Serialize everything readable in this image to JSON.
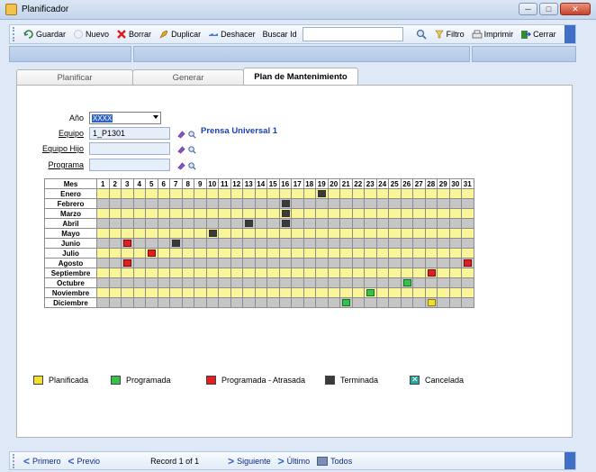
{
  "window": {
    "title": "Planificador"
  },
  "toolbar": {
    "guardar": "Guardar",
    "nuevo": "Nuevo",
    "borrar": "Borrar",
    "duplicar": "Duplicar",
    "deshacer": "Deshacer",
    "buscar_id": "Buscar Id",
    "filtro": "Filtro",
    "imprimir": "Imprimir",
    "cerrar": "Cerrar"
  },
  "tabs": [
    {
      "label": "Planificar"
    },
    {
      "label": "Generar"
    },
    {
      "label": "Plan de Mantenimiento"
    }
  ],
  "form": {
    "anio_label": "Año",
    "anio_value": "XXXX",
    "equipo_label": "Equipo",
    "equipo_value": "1_P1301",
    "equipo_desc": "Prensa Universal 1",
    "equipo_hijo_label": "Equipo Hijo",
    "equipo_hijo_value": "",
    "programa_label": "Programa",
    "programa_value": ""
  },
  "calendar": {
    "header_mes": "Mes",
    "days": [
      "1",
      "2",
      "3",
      "4",
      "5",
      "6",
      "7",
      "8",
      "9",
      "10",
      "11",
      "12",
      "13",
      "14",
      "15",
      "16",
      "17",
      "18",
      "19",
      "20",
      "21",
      "22",
      "23",
      "24",
      "25",
      "26",
      "27",
      "28",
      "29",
      "30",
      "31"
    ],
    "months": [
      "Enero",
      "Febrero",
      "Marzo",
      "Abril",
      "Mayo",
      "Junio",
      "Julio",
      "Agosto",
      "Septiembre",
      "Octubre",
      "Noviembre",
      "Diciembre"
    ],
    "marks": [
      {
        "month": "Enero",
        "day": 19,
        "status": "terminada"
      },
      {
        "month": "Febrero",
        "day": 16,
        "status": "terminada"
      },
      {
        "month": "Marzo",
        "day": 16,
        "status": "terminada"
      },
      {
        "month": "Abril",
        "day": 13,
        "status": "terminada"
      },
      {
        "month": "Abril",
        "day": 16,
        "status": "terminada"
      },
      {
        "month": "Mayo",
        "day": 10,
        "status": "terminada"
      },
      {
        "month": "Junio",
        "day": 3,
        "status": "atrasada"
      },
      {
        "month": "Junio",
        "day": 7,
        "status": "terminada"
      },
      {
        "month": "Julio",
        "day": 5,
        "status": "atrasada"
      },
      {
        "month": "Agosto",
        "day": 3,
        "status": "atrasada"
      },
      {
        "month": "Agosto",
        "day": 31,
        "status": "atrasada"
      },
      {
        "month": "Septiembre",
        "day": 28,
        "status": "atrasada"
      },
      {
        "month": "Octubre",
        "day": 26,
        "status": "programada"
      },
      {
        "month": "Noviembre",
        "day": 23,
        "status": "programada"
      },
      {
        "month": "Diciembre",
        "day": 21,
        "status": "programada"
      },
      {
        "month": "Diciembre",
        "day": 28,
        "status": "planificada"
      }
    ]
  },
  "legend": {
    "planificada": "Planificada",
    "programada": "Programada",
    "atrasada": "Programada - Atrasada",
    "terminada": "Terminada",
    "cancelada": "Cancelada"
  },
  "navigation": {
    "primero": "Primero",
    "previo": "Previo",
    "record": "Record 1 of 1",
    "siguiente": "Siguiente",
    "ultimo": "Último",
    "todos": "Todos"
  }
}
